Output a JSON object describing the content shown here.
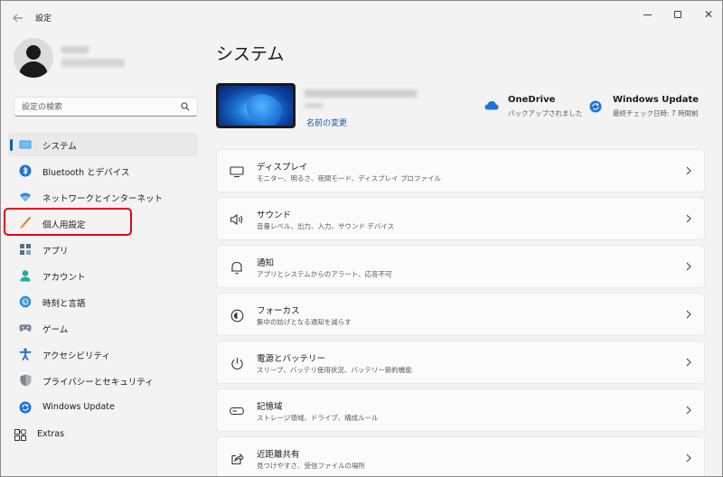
{
  "window": {
    "title": "設定",
    "back_icon": "arrow-left-icon",
    "controls": [
      "minimize-icon",
      "maximize-icon",
      "close-icon"
    ],
    "close_glyph": "✕"
  },
  "sidebar": {
    "search_placeholder": "設定の検索",
    "items": [
      {
        "label": "システム",
        "icon": "system-display-icon",
        "selected": true
      },
      {
        "label": "Bluetooth とデバイス",
        "icon": "bluetooth-icon"
      },
      {
        "label": "ネットワークとインターネット",
        "icon": "wifi-icon"
      },
      {
        "label": "個人用設定",
        "icon": "paint-brush-icon",
        "highlighted": true
      },
      {
        "label": "アプリ",
        "icon": "apps-icon"
      },
      {
        "label": "アカウント",
        "icon": "account-icon"
      },
      {
        "label": "時刻と言語",
        "icon": "globe-clock-icon"
      },
      {
        "label": "ゲーム",
        "icon": "gamepad-icon"
      },
      {
        "label": "アクセシビリティ",
        "icon": "accessibility-icon"
      },
      {
        "label": "プライバシーとセキュリティ",
        "icon": "shield-icon"
      },
      {
        "label": "Windows Update",
        "icon": "windows-update-icon"
      },
      {
        "label": "Extras",
        "icon": "extras-grid-icon"
      }
    ]
  },
  "main": {
    "title": "システム",
    "device": {
      "rename_link": "名前の変更"
    },
    "status": {
      "onedrive": {
        "title": "OneDrive",
        "subtitle": "バックアップされました",
        "icon": "cloud-icon"
      },
      "windows_update": {
        "title": "Windows Update",
        "subtitle": "最終チェック日時: 7 時間前",
        "icon": "windows-update-icon"
      }
    },
    "cards": [
      {
        "title": "ディスプレイ",
        "subtitle": "モニター、明るさ、夜間モード、ディスプレイ プロファイル",
        "icon": "display-monitor-icon"
      },
      {
        "title": "サウンド",
        "subtitle": "音量レベル、出力、入力、サウンド デバイス",
        "icon": "speaker-icon"
      },
      {
        "title": "通知",
        "subtitle": "アプリとシステムからのアラート、応答不可",
        "icon": "bell-icon"
      },
      {
        "title": "フォーカス",
        "subtitle": "集中の妨げとなる通知を減らす",
        "icon": "focus-icon"
      },
      {
        "title": "電源とバッテリー",
        "subtitle": "スリープ、バッテリ使用状況、バッテリー節約機能",
        "icon": "power-icon"
      },
      {
        "title": "記憶域",
        "subtitle": "ストレージ領域、ドライブ、構成ルール",
        "icon": "storage-drive-icon"
      },
      {
        "title": "近距離共有",
        "subtitle": "見つけやすさ、受信ファイルの場所",
        "icon": "share-icon"
      }
    ]
  },
  "colors": {
    "accent": "#005fb8",
    "highlight_box": "#e8001a",
    "link": "#0a5fb4"
  }
}
